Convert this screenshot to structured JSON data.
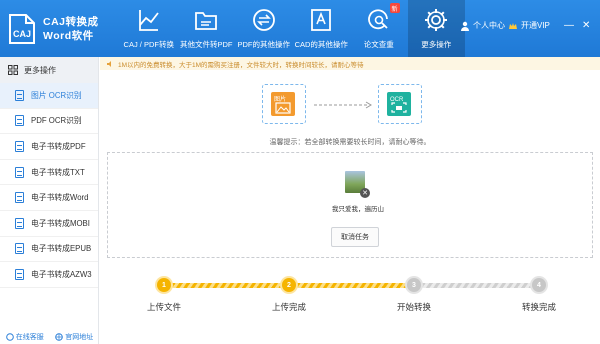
{
  "app": {
    "title_line1": "CAJ转换成",
    "title_line2": "Word软件"
  },
  "nav": [
    {
      "label": "CAJ / PDF转换",
      "icon": "convert-icon"
    },
    {
      "label": "其他文件转PDF",
      "icon": "folder-icon"
    },
    {
      "label": "PDF的其他操作",
      "icon": "swap-icon"
    },
    {
      "label": "CAD的其他操作",
      "icon": "cad-icon"
    },
    {
      "label": "论文查重",
      "icon": "search-c-icon",
      "badge": "新"
    },
    {
      "label": "更多操作",
      "icon": "gear-icon",
      "active": true
    }
  ],
  "header": {
    "user_label": "个人中心",
    "vip_label": "开通VIP",
    "minimize": "—",
    "close": "✕"
  },
  "sidebar": {
    "head": "更多操作",
    "items": [
      {
        "label": "图片 OCR识别",
        "active": true
      },
      {
        "label": "PDF OCR识别"
      },
      {
        "label": "电子书转成PDF"
      },
      {
        "label": "电子书转成TXT"
      },
      {
        "label": "电子书转成Word"
      },
      {
        "label": "电子书转成MOBI"
      },
      {
        "label": "电子书转成EPUB"
      },
      {
        "label": "电子书转成AZW3"
      }
    ],
    "footer_service": "在线客服",
    "footer_site": "官网地址"
  },
  "notice": "1M以内的免费转换，大于1M的需购买注册，文件较大时，转换时间较长，请耐心等待",
  "flow": {
    "from_label": "图片",
    "to_label": "OCR"
  },
  "tip": "温馨提示：若全部转换需要较长时间，请耐心等待。",
  "file": {
    "name": "我只爱我，遍历山",
    "remove": "✕"
  },
  "cancel_label": "取消任务",
  "steps": [
    {
      "num": "1",
      "label": "上传文件",
      "done": true
    },
    {
      "num": "2",
      "label": "上传完成",
      "done": true
    },
    {
      "num": "3",
      "label": "开始转换",
      "done": false
    },
    {
      "num": "4",
      "label": "转换完成",
      "done": false
    }
  ],
  "colors": {
    "header": "#2286de",
    "accent": "#2b7fd8",
    "step_done": "#f5b400",
    "step_todo": "#c7c7c7"
  }
}
